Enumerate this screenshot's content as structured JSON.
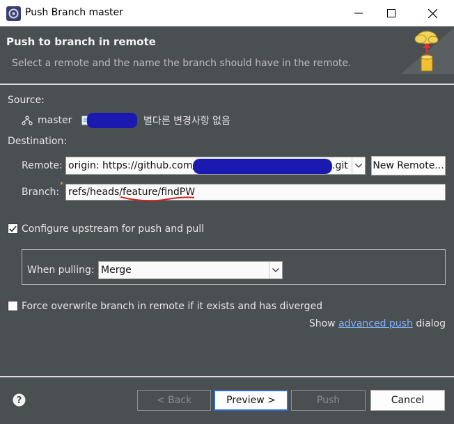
{
  "window": {
    "title": "Push Branch master"
  },
  "header": {
    "title": "Push to branch in remote",
    "description": "Select a remote and the name the branch should have in the remote."
  },
  "source": {
    "label": "Source:",
    "branch": "master",
    "commit_message": "별다른 변경사항 없음"
  },
  "destination": {
    "label": "Destination:",
    "remote_label": "Remote:",
    "remote_prefix": "origin: https://github.com/",
    "remote_suffix": ".git",
    "new_remote_label": "New Remote...",
    "branch_label": "Branch:",
    "branch_value": "refs/heads/feature/findPW"
  },
  "upstream": {
    "checkbox_label": "Configure upstream for push and pull",
    "checked": true,
    "when_pulling_label": "When pulling:",
    "when_pulling_value": "Merge"
  },
  "force": {
    "checkbox_label": "Force overwrite branch in remote if it exists and has diverged",
    "checked": false
  },
  "advanced": {
    "prefix": "Show ",
    "link": "advanced push",
    "suffix": " dialog"
  },
  "footer": {
    "back_label": "< Back",
    "preview_label": "Preview >",
    "push_label": "Push",
    "cancel_label": "Cancel"
  },
  "icons": [
    "eclipse-app-icon",
    "minimize-icon",
    "maximize-icon",
    "close-icon",
    "cloud-upload-icon",
    "branch-icon",
    "commit-icon",
    "help-icon",
    "chevron-down-icon"
  ]
}
